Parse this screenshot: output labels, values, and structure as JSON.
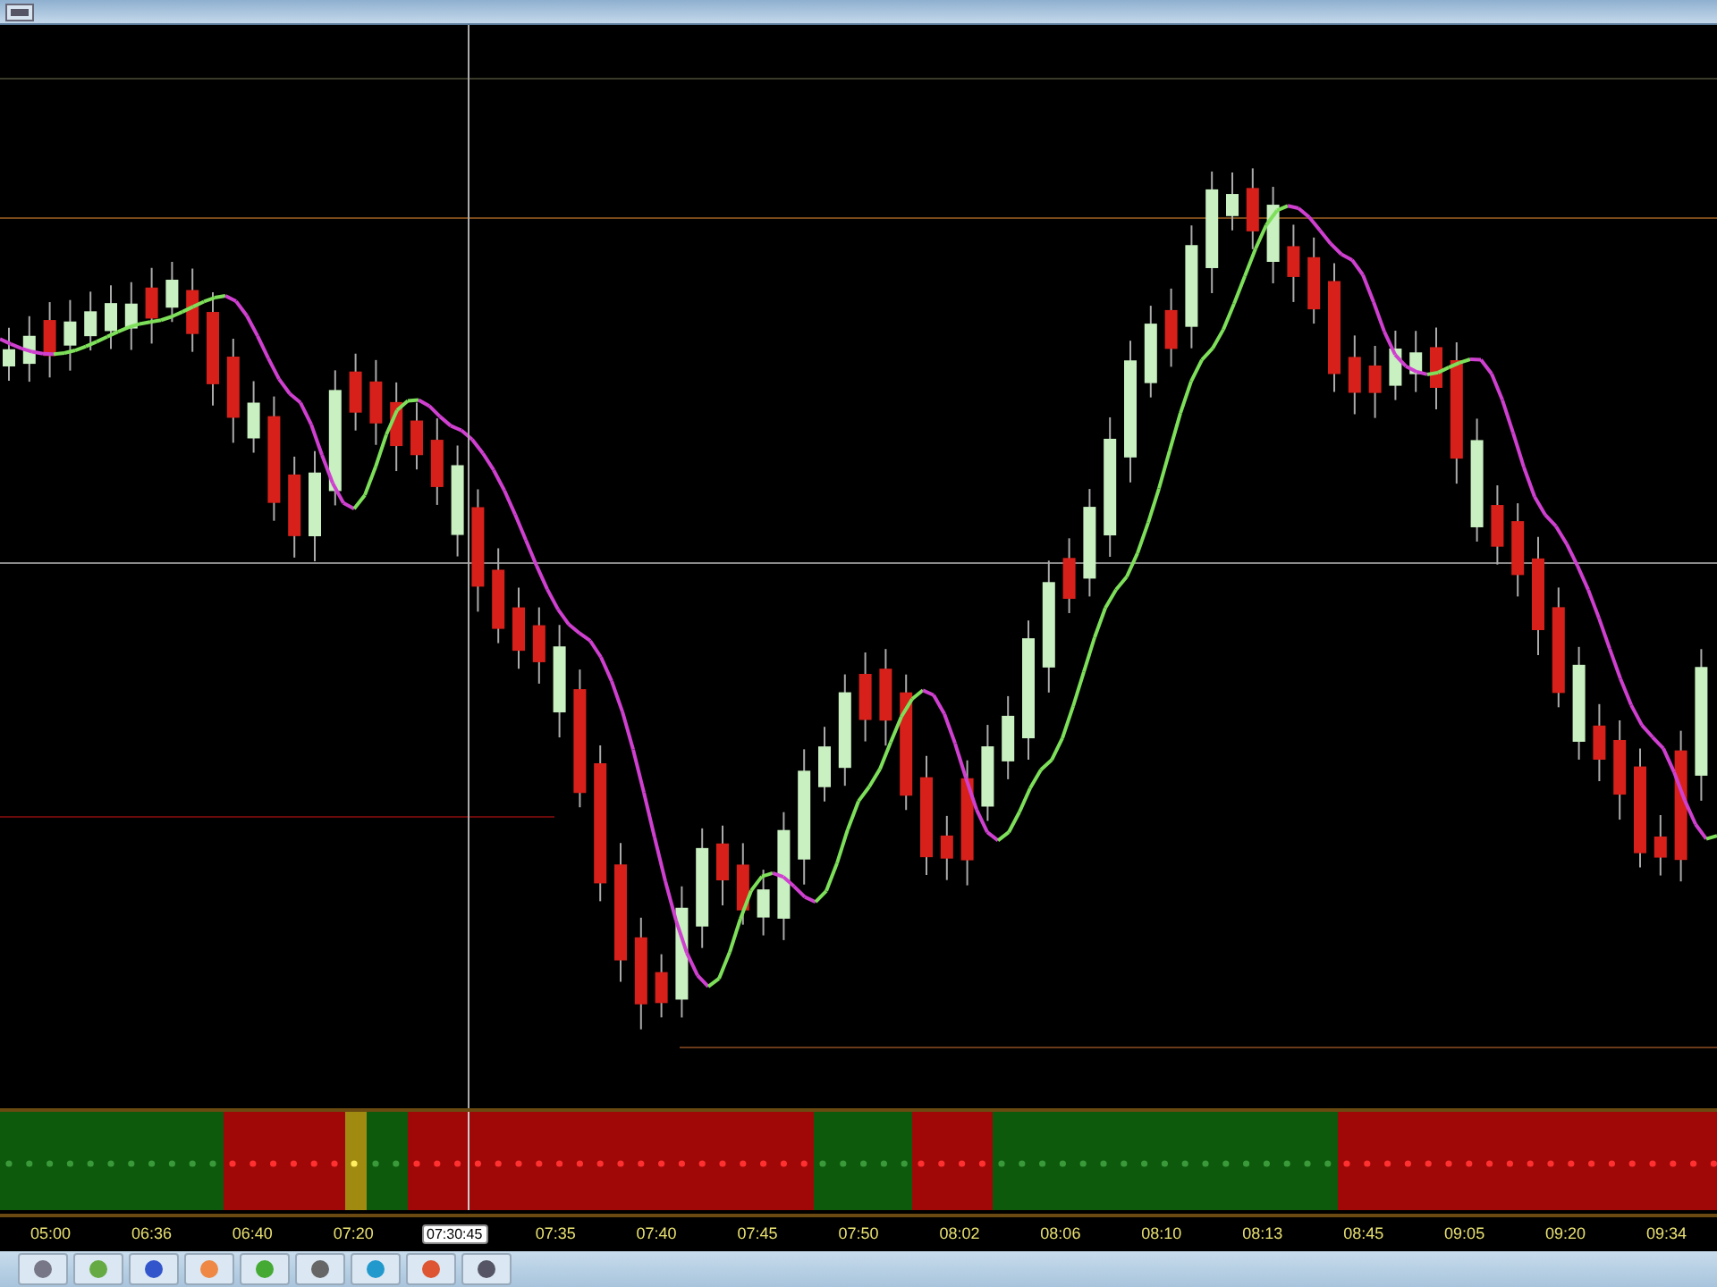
{
  "time_axis": [
    {
      "label": "05:00",
      "kind": "tick"
    },
    {
      "label": "06:36",
      "kind": "tick"
    },
    {
      "label": "06:40",
      "kind": "tick"
    },
    {
      "label": "07:20",
      "kind": "tick"
    },
    {
      "label": "07:30:45",
      "kind": "crosshair"
    },
    {
      "label": "07:35",
      "kind": "tick"
    },
    {
      "label": "07:40",
      "kind": "tick"
    },
    {
      "label": "07:45",
      "kind": "tick"
    },
    {
      "label": "07:50",
      "kind": "tick"
    },
    {
      "label": "08:02",
      "kind": "tick"
    },
    {
      "label": "08:06",
      "kind": "tick"
    },
    {
      "label": "08:10",
      "kind": "tick"
    },
    {
      "label": "08:13",
      "kind": "tick"
    },
    {
      "label": "08:45",
      "kind": "tick"
    },
    {
      "label": "09:05",
      "kind": "tick"
    },
    {
      "label": "09:20",
      "kind": "tick"
    },
    {
      "label": "09:34",
      "kind": "tick"
    }
  ]
}
